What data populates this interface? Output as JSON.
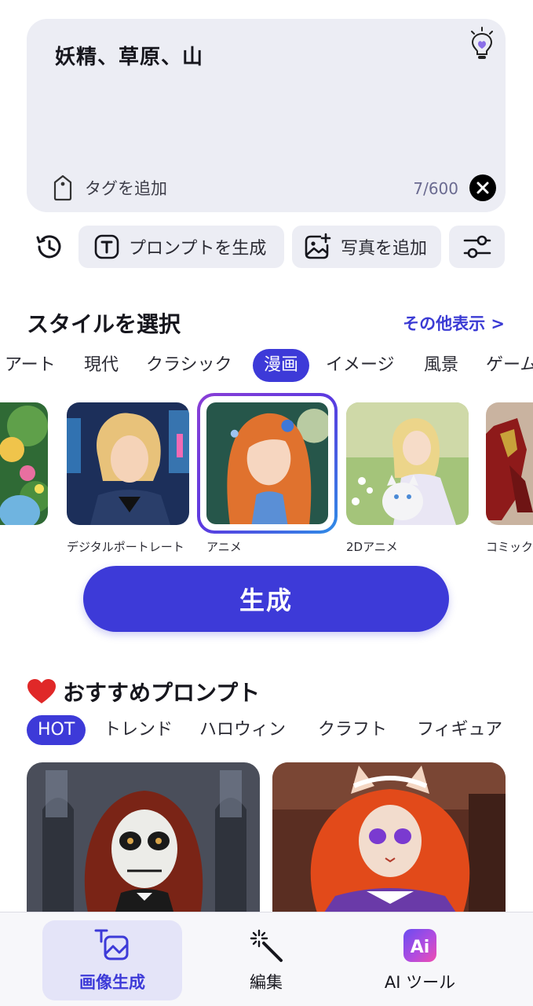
{
  "prompt": {
    "text": "妖精、草原、山",
    "tag_label": "タグを追加",
    "counter": "7/600"
  },
  "actions": {
    "generate_prompt_label": "プロンプトを生成",
    "add_photo_label": "写真を追加"
  },
  "styles": {
    "title": "スタイルを選択",
    "more_link": "その他表示 >",
    "categories": [
      "アート",
      "現代",
      "クラシック",
      "漫画",
      "イメージ",
      "風景",
      "ゲーム"
    ],
    "active_category": "漫画",
    "items": [
      {
        "label": ""
      },
      {
        "label": "デジタルポートレート"
      },
      {
        "label": "アニメ"
      },
      {
        "label": "2Dアニメ"
      },
      {
        "label": "コミック"
      }
    ],
    "selected": "アニメ"
  },
  "generate_label": "生成",
  "recommended": {
    "title": "おすすめプロンプト",
    "tabs": [
      "HOT",
      "トレンド",
      "ハロウィン",
      "クラフト",
      "フィギュア"
    ],
    "active_tab": "HOT"
  },
  "nav": {
    "items": [
      {
        "label": "画像生成",
        "icon": "image-generate-icon"
      },
      {
        "label": "編集",
        "icon": "magic-wand-icon"
      },
      {
        "label": "AI ツール",
        "icon": "ai-tools-icon"
      }
    ],
    "active": "画像生成"
  },
  "colors": {
    "accent": "#3d3ad8",
    "surface": "#ecedf4",
    "link": "#3b3bd4"
  }
}
